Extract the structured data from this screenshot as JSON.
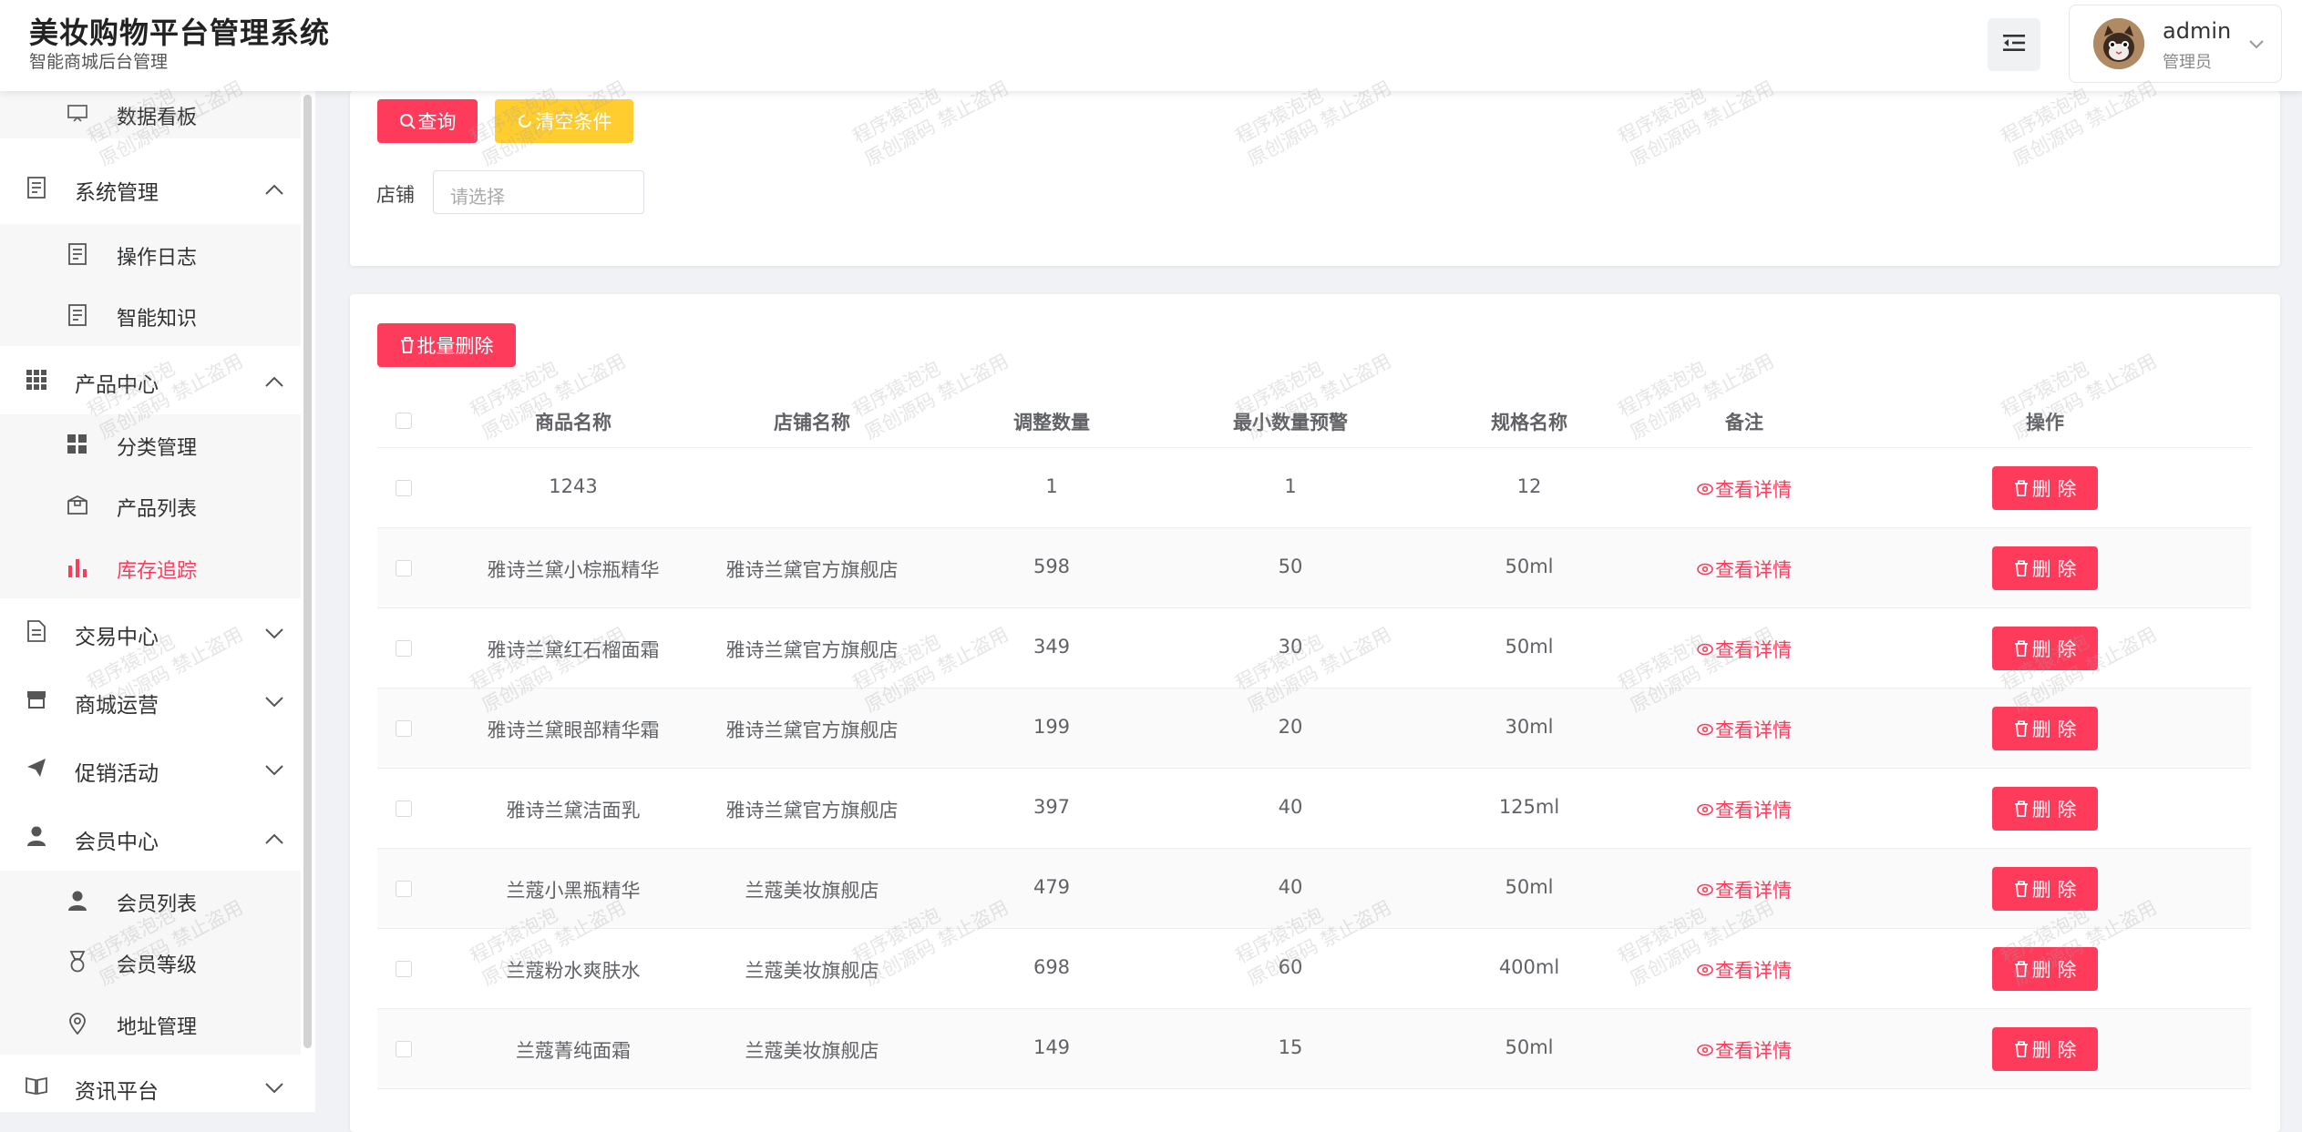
{
  "header": {
    "title": "美妆购物平台管理系统",
    "subtitle": "智能商城后台管理",
    "user_name": "admin",
    "user_role": "管理员"
  },
  "sidebar": {
    "items": [
      {
        "label": "数据看板",
        "icon": "board-icon",
        "level": "sub"
      },
      {
        "label": "系统管理",
        "icon": "document-icon",
        "level": "parent",
        "expanded": true
      },
      {
        "label": "操作日志",
        "icon": "document-icon",
        "level": "sub"
      },
      {
        "label": "智能知识",
        "icon": "document-icon",
        "level": "sub"
      },
      {
        "label": "产品中心",
        "icon": "grid-icon",
        "level": "parent",
        "expanded": true
      },
      {
        "label": "分类管理",
        "icon": "category-icon",
        "level": "sub"
      },
      {
        "label": "产品列表",
        "icon": "box-icon",
        "level": "sub"
      },
      {
        "label": "库存追踪",
        "icon": "bar-chart-icon",
        "level": "sub",
        "active": true
      },
      {
        "label": "交易中心",
        "icon": "order-icon",
        "level": "parent",
        "expanded": false
      },
      {
        "label": "商城运营",
        "icon": "shop-icon",
        "level": "parent",
        "expanded": false
      },
      {
        "label": "促销活动",
        "icon": "send-icon",
        "level": "parent",
        "expanded": false
      },
      {
        "label": "会员中心",
        "icon": "user-icon",
        "level": "parent",
        "expanded": true
      },
      {
        "label": "会员列表",
        "icon": "user-icon",
        "level": "sub"
      },
      {
        "label": "会员等级",
        "icon": "medal-icon",
        "level": "sub"
      },
      {
        "label": "地址管理",
        "icon": "location-icon",
        "level": "sub"
      },
      {
        "label": "资讯平台",
        "icon": "book-icon",
        "level": "parent",
        "expanded": false
      }
    ]
  },
  "filter": {
    "query_label": "查询",
    "clear_label": "清空条件",
    "shop_label": "店铺",
    "shop_placeholder": "请选择"
  },
  "table": {
    "batch_delete_label": "批量删除",
    "columns": [
      "商品名称",
      "店铺名称",
      "调整数量",
      "最小数量预警",
      "规格名称",
      "备注",
      "操作"
    ],
    "detail_label": "查看详情",
    "delete_label": "删 除",
    "rows": [
      {
        "name": "1243",
        "shop": "",
        "qty": "1",
        "min": "1",
        "spec": "12"
      },
      {
        "name": "雅诗兰黛小棕瓶精华",
        "shop": "雅诗兰黛官方旗舰店",
        "qty": "598",
        "min": "50",
        "spec": "50ml"
      },
      {
        "name": "雅诗兰黛红石榴面霜",
        "shop": "雅诗兰黛官方旗舰店",
        "qty": "349",
        "min": "30",
        "spec": "50ml"
      },
      {
        "name": "雅诗兰黛眼部精华霜",
        "shop": "雅诗兰黛官方旗舰店",
        "qty": "199",
        "min": "20",
        "spec": "30ml"
      },
      {
        "name": "雅诗兰黛洁面乳",
        "shop": "雅诗兰黛官方旗舰店",
        "qty": "397",
        "min": "40",
        "spec": "125ml"
      },
      {
        "name": "兰蔻小黑瓶精华",
        "shop": "兰蔻美妆旗舰店",
        "qty": "479",
        "min": "40",
        "spec": "50ml"
      },
      {
        "name": "兰蔻粉水爽肤水",
        "shop": "兰蔻美妆旗舰店",
        "qty": "698",
        "min": "60",
        "spec": "400ml"
      },
      {
        "name": "兰蔻菁纯面霜",
        "shop": "兰蔻美妆旗舰店",
        "qty": "149",
        "min": "15",
        "spec": "50ml"
      }
    ]
  },
  "watermark": {
    "line1": "程序猿泡泡",
    "line2": "原创源码 禁止盗用"
  },
  "colors": {
    "accent": "#ff3b5c",
    "warning": "#ffcd2e"
  }
}
